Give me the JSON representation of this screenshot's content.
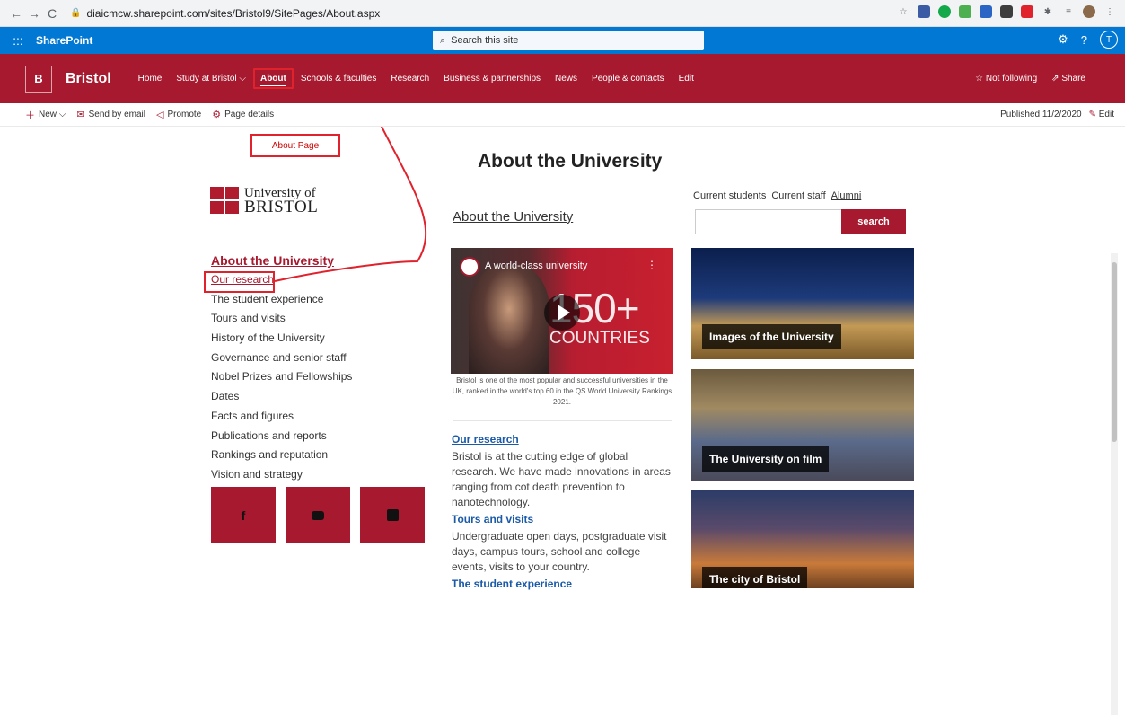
{
  "browser": {
    "url": "diaicmcw.sharepoint.com/sites/Bristol9/SitePages/About.aspx",
    "back": "←",
    "forward": "→",
    "reload": "C"
  },
  "suite": {
    "waffle": ":::",
    "title": "SharePoint",
    "search_placeholder": "Search this site",
    "help": "?",
    "avatar": "T"
  },
  "site": {
    "logo_letter": "B",
    "name": "Bristol",
    "nav": [
      {
        "label": "Home"
      },
      {
        "label": "Study at Bristol ⌵"
      },
      {
        "label": "About"
      },
      {
        "label": "Schools & faculties"
      },
      {
        "label": "Research"
      },
      {
        "label": "Business & partnerships"
      },
      {
        "label": "News"
      },
      {
        "label": "People & contacts"
      },
      {
        "label": "Edit"
      }
    ],
    "not_following": "☆ Not following",
    "share": "⇗ Share"
  },
  "commands": {
    "new": "New ⌵",
    "send": "Send by email",
    "promote": "Promote",
    "details": "Page details",
    "published": "Published 11/2/2020",
    "edit": "Edit"
  },
  "annotation": {
    "about_page": "About Page"
  },
  "page": {
    "title": "About the University"
  },
  "logo": {
    "line1": "University of",
    "line2": "BRISTOL"
  },
  "left_menu": {
    "title": "About the University",
    "items": [
      "Our research",
      "The student experience",
      "Tours and visits",
      "History of the University",
      "Governance and senior staff",
      "Nobel Prizes and Fellowships",
      "Dates",
      "Facts and figures",
      "Publications and reports",
      "Rankings and reputation",
      "Vision and strategy"
    ]
  },
  "social": {
    "facebook": "f",
    "youtube": "▶",
    "linkedin": "in"
  },
  "middle": {
    "heading": "About the University",
    "video_title": "A world-class university",
    "video_big": "150+",
    "video_small": "COUNTRIES",
    "caption": "Bristol is one of the most popular and successful universities in the UK, ranked in the world's top 60 in the QS World University Rankings 2021.",
    "research_h": "Our research",
    "research_p": "Bristol is at the cutting edge of global research. We have made innovations in areas ranging from cot death prevention to nanotechnology.",
    "tours_h": "Tours and visits",
    "tours_p": "Undergraduate open days, postgraduate visit days, campus tours, school and college events, visits to your country.",
    "student_h": "The student experience"
  },
  "right": {
    "links": [
      "Current students",
      "Current staff",
      "Alumni"
    ],
    "search_btn": "search",
    "tiles": [
      "Images of the University",
      "The University on film",
      "The city of Bristol"
    ]
  },
  "colors": {
    "brand_red": "#a6192e",
    "sharepoint_blue": "#0078d4",
    "annotation_red": "#e0222d",
    "link_blue": "#1a5aa8"
  }
}
